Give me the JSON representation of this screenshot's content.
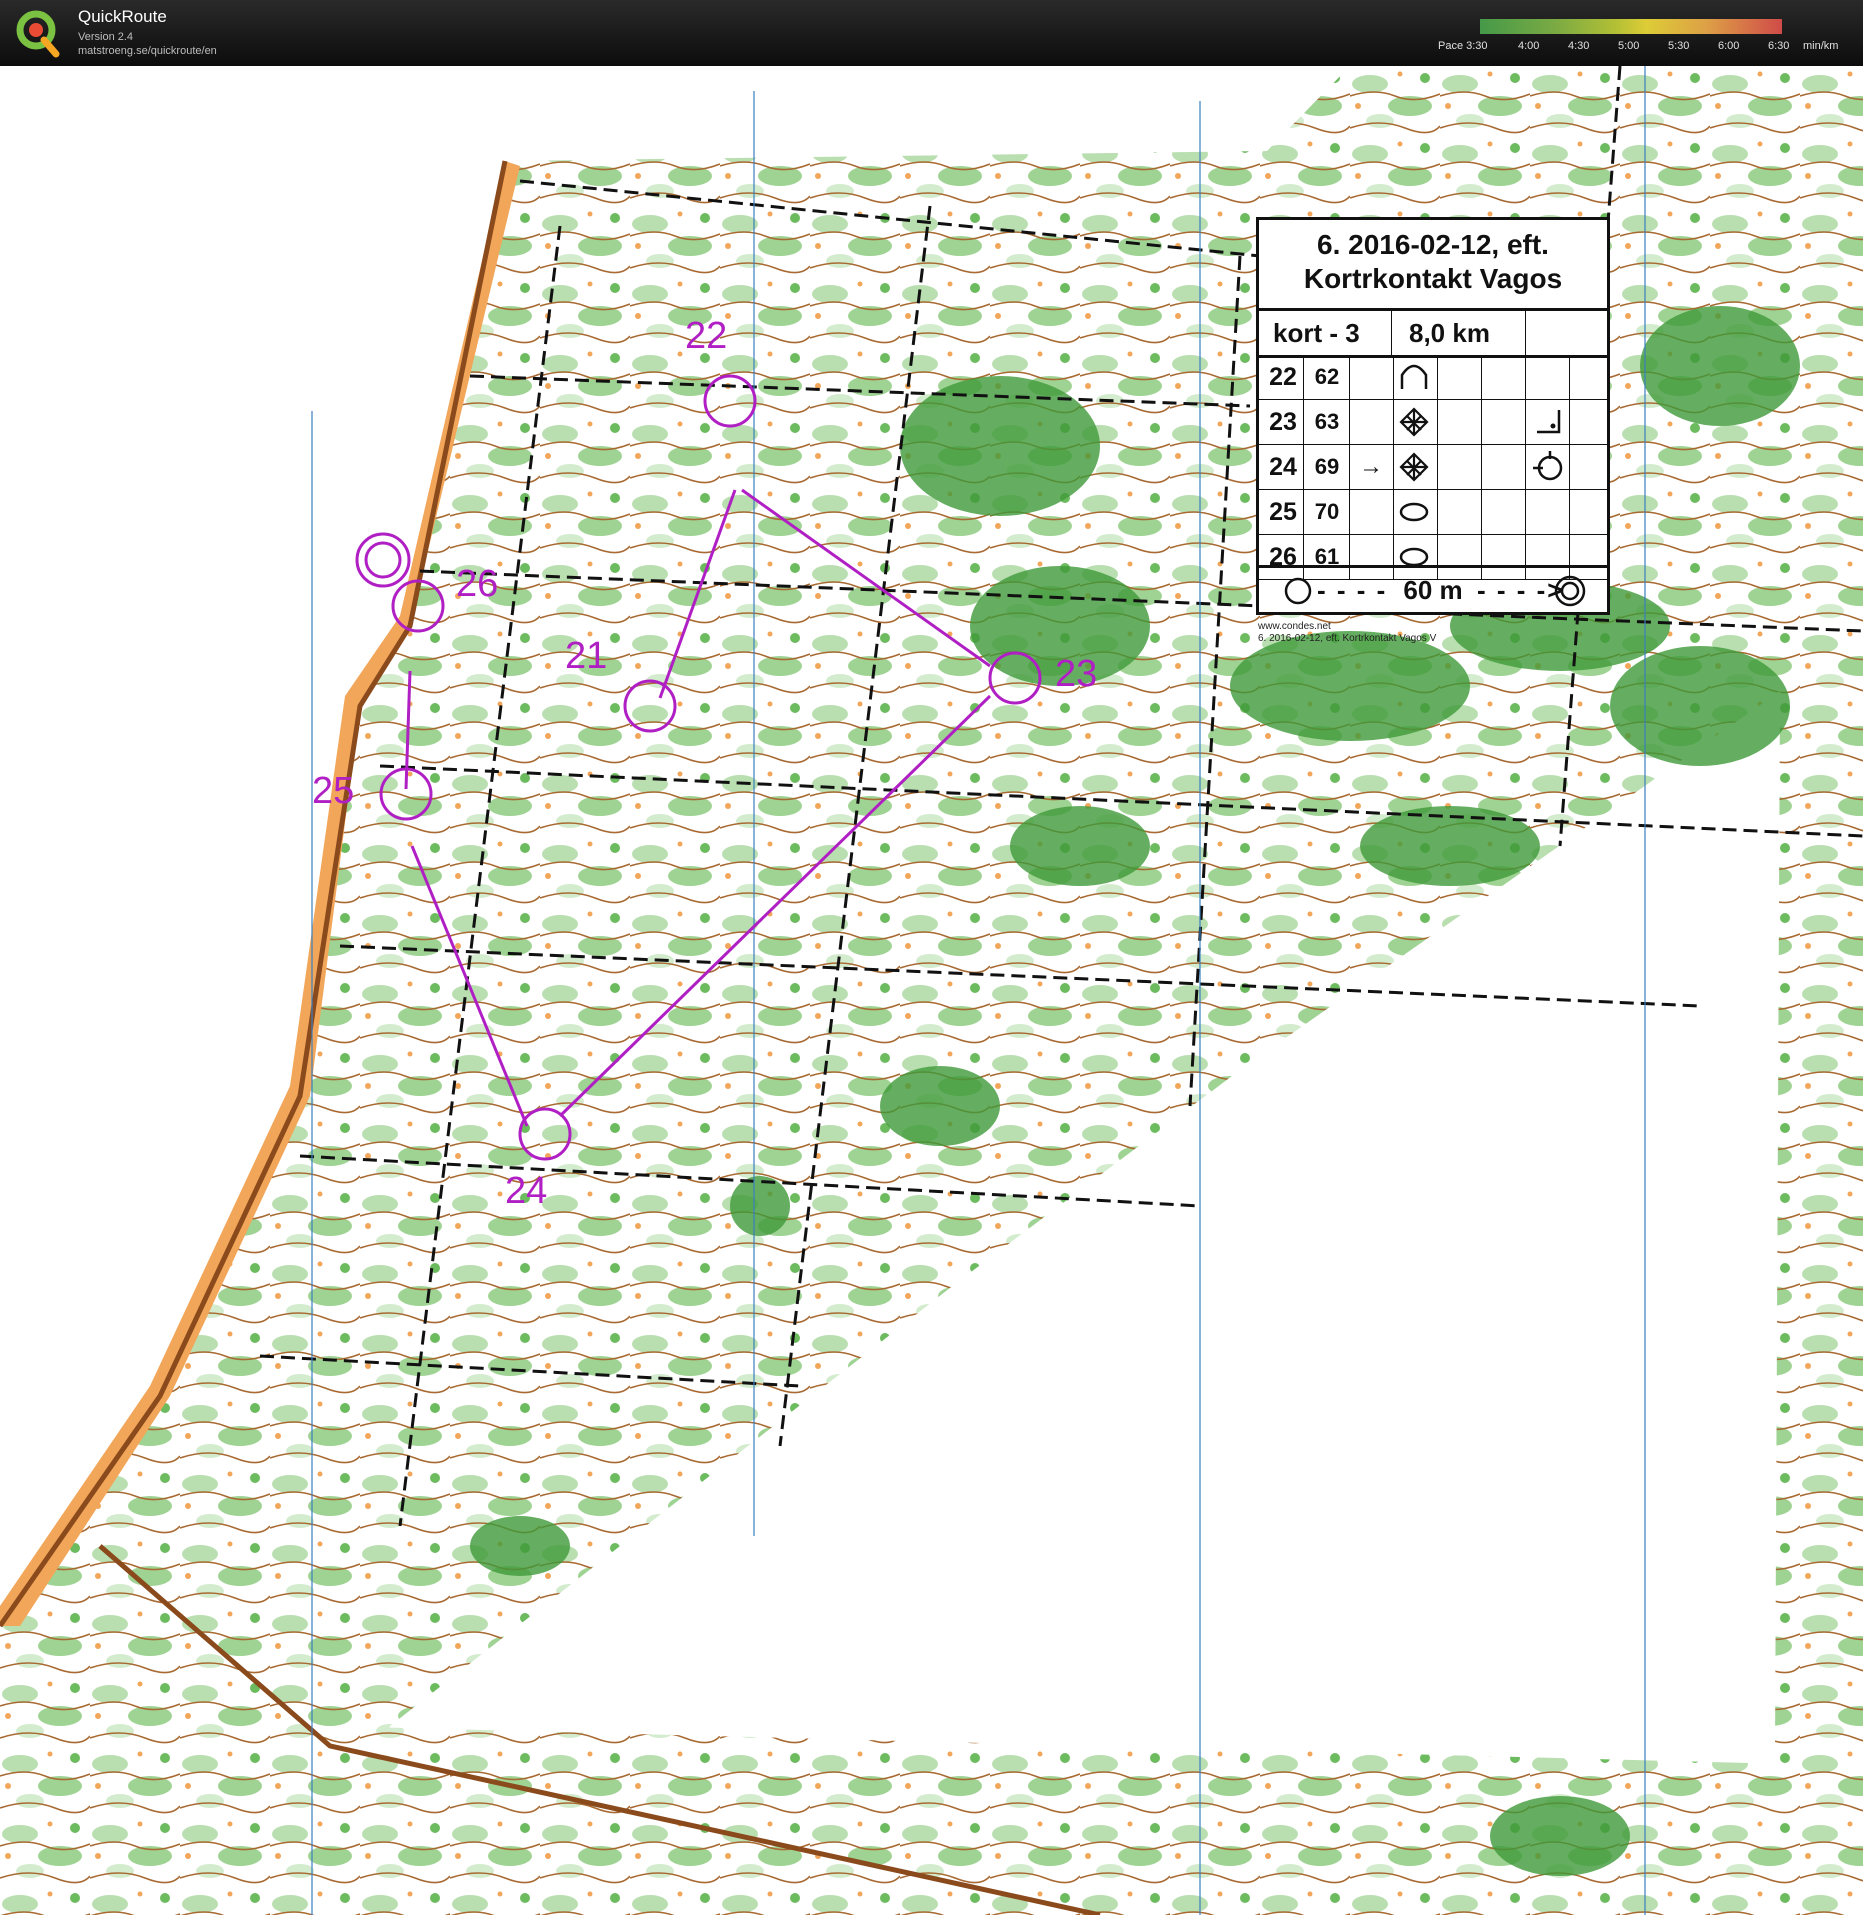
{
  "app": {
    "name": "QuickRoute",
    "version": "Version 2.4",
    "url": "matstroeng.se/quickroute/en"
  },
  "pace_scale": {
    "labels": [
      "Pace 3:30",
      "4:00",
      "4:30",
      "5:00",
      "5:30",
      "6:00",
      "6:30",
      "min/km"
    ]
  },
  "control_card": {
    "title_line1": "6. 2016-02-12, eft.",
    "title_line2": "Kortrkontakt Vagos",
    "course": "kort - 3",
    "length": "8,0 km",
    "controls": [
      {
        "num": "22",
        "code": "62",
        "dir": ""
      },
      {
        "num": "23",
        "code": "63",
        "dir": ""
      },
      {
        "num": "24",
        "code": "69",
        "dir": "→"
      },
      {
        "num": "25",
        "code": "70",
        "dir": ""
      },
      {
        "num": "26",
        "code": "61",
        "dir": ""
      }
    ],
    "finish_text": "60 m"
  },
  "map_credit": {
    "line1": "www.condes.net",
    "line2": "6. 2016-02-12, eft. Kortrkontakt Vagos V"
  },
  "course_controls": [
    {
      "label": "21"
    },
    {
      "label": "22"
    },
    {
      "label": "23"
    },
    {
      "label": "24"
    },
    {
      "label": "25"
    },
    {
      "label": "26"
    }
  ],
  "colors": {
    "course": "#b01fc4",
    "forest": "#3f9a3a",
    "open": "#f2a65a",
    "contour": "#9a5a22"
  }
}
